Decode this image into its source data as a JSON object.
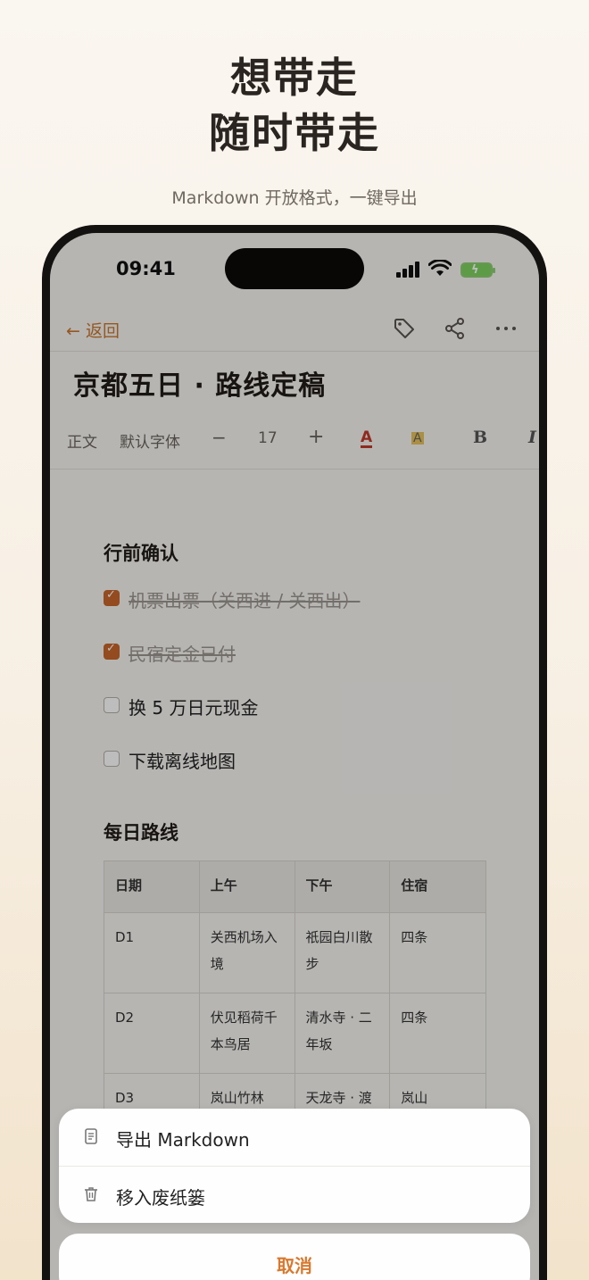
{
  "promo": {
    "title_line1": "想带走",
    "title_line2": "随时带走",
    "subtitle": "Markdown 开放格式，一键导出"
  },
  "status_bar": {
    "time": "09:41"
  },
  "nav": {
    "back_label": "返回"
  },
  "document": {
    "title": "京都五日 · 路线定稿",
    "toolbar": {
      "paragraph_style": "正文",
      "font": "默认字体",
      "decrease": "−",
      "font_size": "17",
      "increase": "+",
      "text_color": "A",
      "highlight": "A",
      "bold": "B",
      "italic": "I"
    },
    "sections": [
      {
        "heading": "行前确认",
        "todos": [
          {
            "label": "机票出票（关西进 / 关西出）",
            "checked": true
          },
          {
            "label": "民宿定金已付",
            "checked": true
          },
          {
            "label": "换 5 万日元现金",
            "checked": false
          },
          {
            "label": "下载离线地图",
            "checked": false
          }
        ]
      },
      {
        "heading": "每日路线",
        "table": {
          "headers": [
            "日期",
            "上午",
            "下午",
            "住宿"
          ],
          "rows": [
            [
              "D1",
              "关西机场入境",
              "祇园白川散步",
              "四条"
            ],
            [
              "D2",
              "伏见稻荷千本鸟居",
              "清水寺 · 二年坂",
              "四条"
            ],
            [
              "D3",
              "岚山竹林",
              "天龙寺 · 渡",
              "岚山"
            ]
          ]
        }
      }
    ]
  },
  "action_sheet": {
    "items": [
      {
        "label": "导出 Markdown",
        "icon": "document-icon"
      },
      {
        "label": "移入废纸篓",
        "icon": "trash-icon"
      }
    ],
    "cancel_label": "取消"
  },
  "colors": {
    "accent": "#c8772f",
    "checkbox": "#c8662a",
    "cancel": "#d9782e"
  }
}
